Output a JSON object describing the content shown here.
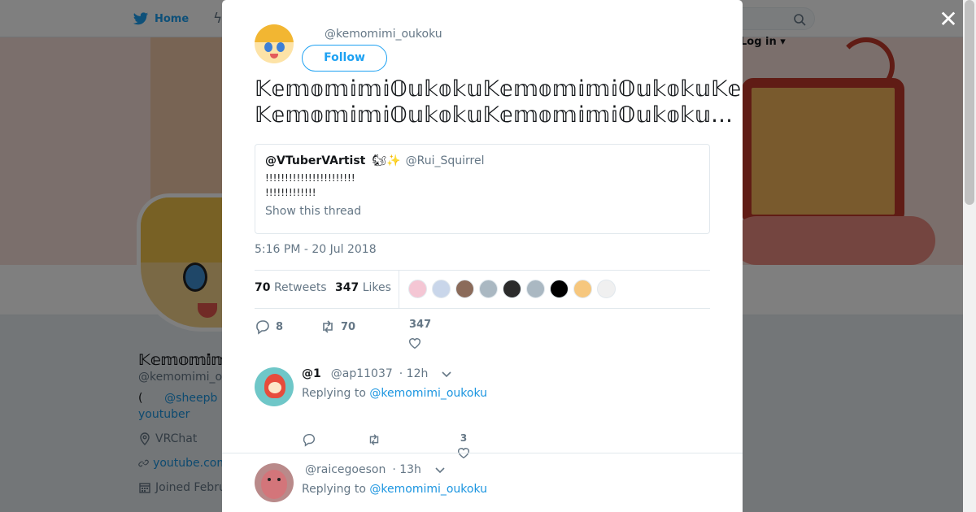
{
  "topbar": {
    "home_label": "Home",
    "login_label": "Log in"
  },
  "profile": {
    "name": "𝕂𝕖𝕞𝕠𝕞𝕚𝕞𝕚𝕆𝕦𝕜𝕠𝕜𝕦",
    "handle": "@kemomimi_oukoku",
    "bio_paren": "(",
    "bio_link": "@sheepb",
    "bio_line2": "youtuber",
    "location": "VRChat",
    "website": "youtube.com",
    "joined": "Joined Febru"
  },
  "tweet": {
    "author_handle": "@kemomimi_oukoku",
    "follow_label": "Follow",
    "text_line1": "𝕂𝕖𝕞𝕠𝕞𝕚𝕞𝕚𝕆𝕦𝕜𝕠𝕜𝕦𝕂𝕖𝕞𝕠𝕞𝕚𝕞𝕚𝕆𝕦𝕜𝕠𝕜𝕦𝕂𝕖𝕞𝕠𝕞𝕚𝕞𝕚𝕆𝕦𝕜𝕠…",
    "text_line2": "𝕂𝕖𝕞𝕠𝕞𝕚𝕞𝕚𝕆𝕦𝕜𝕠𝕜𝕦𝕂𝕖𝕞𝕠𝕞𝕚𝕞𝕚𝕆𝕦𝕜𝕠𝕜𝕦…",
    "quote": {
      "name": "@VTuberVArtist",
      "emoji": "🐿✨",
      "handle": "@Rui_Squirrel",
      "line1": "!!!!!!!!!!!!!!!!!!!!!!!",
      "line2": "!!!!!!!!!!!!!",
      "show_thread": "Show this thread"
    },
    "timestamp": "5:16 PM - 20 Jul 2018",
    "retweets_count": "70",
    "retweets_label": "Retweets",
    "likes_count": "347",
    "likes_label": "Likes",
    "liker_colors": [
      "#f4c6d4",
      "#c9d6ea",
      "#8b6b5a",
      "#aab8c2",
      "#2b2b2b",
      "#aab8c2",
      "#000000",
      "#f6c77e",
      "#f0f0f0"
    ],
    "actions": {
      "replies": "8",
      "retweets": "70",
      "likes": "347"
    }
  },
  "replies": [
    {
      "name": "@1",
      "handle": "@ap11037",
      "time": "· 12h",
      "replying_label": "Replying to",
      "replying_to": "@kemomimi_oukoku",
      "likes": "3"
    },
    {
      "name": "",
      "handle": "@raicegoeson",
      "time": "· 13h",
      "replying_label": "Replying to",
      "replying_to": "@kemomimi_oukoku"
    }
  ],
  "colors": {
    "accent": "#1da1f2",
    "link": "#1b95e0",
    "muted": "#657786"
  },
  "icons": [
    "twitter-bird-icon",
    "lightning-icon",
    "search-icon",
    "close-icon",
    "reply-icon",
    "retweet-icon",
    "heart-icon",
    "chevron-down-icon",
    "location-icon",
    "link-icon",
    "calendar-icon"
  ]
}
